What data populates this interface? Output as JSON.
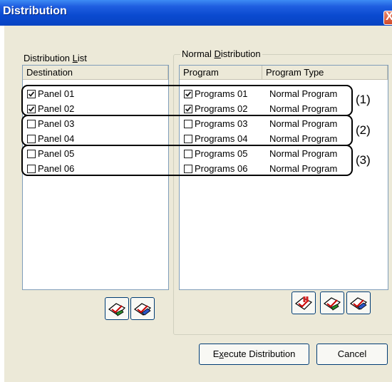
{
  "window": {
    "title": "Distribution",
    "close_glyph": "X"
  },
  "distribution_list": {
    "label_pre": "Distribution ",
    "label_key": "L",
    "label_post": "ist",
    "column_header": "Destination",
    "items": [
      {
        "label": "Panel 01",
        "checked": true
      },
      {
        "label": "Panel 02",
        "checked": true
      },
      {
        "label": "Panel 03",
        "checked": false
      },
      {
        "label": "Panel 04",
        "checked": false
      },
      {
        "label": "Panel 05",
        "checked": false
      },
      {
        "label": "Panel 06",
        "checked": false
      }
    ],
    "buttons": [
      {
        "icon": "check-all-icon"
      },
      {
        "icon": "clear-all-icon"
      }
    ]
  },
  "normal_distribution": {
    "label_pre": "Normal ",
    "label_key": "D",
    "label_post": "istribution",
    "column_headers": [
      "Program",
      "Program Type"
    ],
    "items": [
      {
        "program": "Programs 01",
        "type": "Normal Program",
        "checked": true
      },
      {
        "program": "Programs 02",
        "type": "Normal Program",
        "checked": true
      },
      {
        "program": "Programs 03",
        "type": "Normal Program",
        "checked": false
      },
      {
        "program": "Programs 04",
        "type": "Normal Program",
        "checked": false
      },
      {
        "program": "Programs 05",
        "type": "Normal Program",
        "checked": false
      },
      {
        "program": "Programs 06",
        "type": "Normal Program",
        "checked": false
      }
    ],
    "buttons": [
      {
        "icon": "open-program-icon"
      },
      {
        "icon": "check-all-icon"
      },
      {
        "icon": "clear-all-icon"
      }
    ]
  },
  "annotations": [
    "(1)",
    "(2)",
    "(3)"
  ],
  "footer": {
    "execute_pre": "E",
    "execute_key": "x",
    "execute_post": "ecute Distribution",
    "cancel_label": "Cancel"
  },
  "colors": {
    "title_bar": "#0a4ad0",
    "dialog_bg": "#ece9d8",
    "list_border": "#7f9db9",
    "annotation_stroke": "#000000"
  }
}
